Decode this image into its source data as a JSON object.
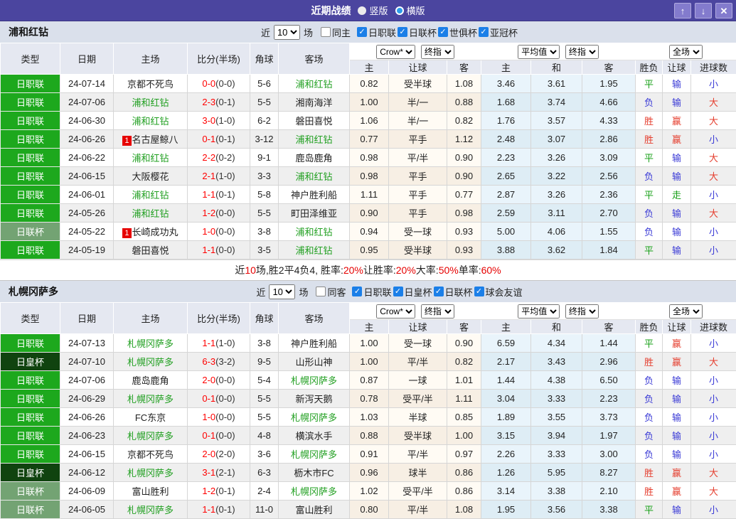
{
  "titlebar": {
    "title": "近期战绩",
    "radios": [
      {
        "label": "竖版",
        "selected": true
      },
      {
        "label": "横版",
        "selected": false
      }
    ],
    "buttons": {
      "up": "↑",
      "down": "↓",
      "close": "✕"
    }
  },
  "icons": {
    "check": "✓"
  },
  "colors": {
    "titlebar_bg": "#4B459F",
    "league": {
      "日职联": "#1DA81D",
      "日联杯": "#73A373",
      "日皇杯": "#10430F"
    },
    "result": {
      "胜": "#E53E2E",
      "负": "#3A3AD6",
      "平": "#19A019",
      "赢": "#E53E2E",
      "输": "#3A3AD6",
      "走": "#19A019",
      "大": "#E53E2E",
      "小": "#3A3AD6"
    },
    "highlight_team": "#22A022",
    "score_red": "#FF0000"
  },
  "table_header": {
    "cols": [
      "类型",
      "日期",
      "主场",
      "比分(半场)",
      "角球",
      "客场"
    ],
    "sub": [
      "主",
      "让球",
      "客",
      "主",
      "和",
      "客",
      "胜负",
      "让球",
      "进球数"
    ]
  },
  "sections": [
    {
      "team": "浦和红钻",
      "near_label": "近",
      "count": "10",
      "matches_label": "场",
      "same_label": "同主",
      "leagues": [
        "日职联",
        "日联杯",
        "世俱杯",
        "亚冠杯"
      ],
      "selects": {
        "book": "Crow*",
        "book_time": "终指",
        "avg": "平均值",
        "avg_time": "终指",
        "scope": "全场"
      },
      "rows": [
        {
          "lg": "日职联",
          "date": "24-07-14",
          "home": "京都不死鸟",
          "mark": "",
          "score": "0-0",
          "half": "(0-0)",
          "corner": "5-6",
          "away": "浦和红钻",
          "o": [
            "0.82",
            "受半球",
            "1.08"
          ],
          "a": [
            "3.46",
            "3.61",
            "1.95"
          ],
          "r": [
            "平",
            "输",
            "小"
          ]
        },
        {
          "lg": "日职联",
          "date": "24-07-06",
          "home": "浦和红钻",
          "mark": "",
          "score": "2-3",
          "half": "(0-1)",
          "corner": "5-5",
          "away": "湘南海洋",
          "o": [
            "1.00",
            "半/一",
            "0.88"
          ],
          "a": [
            "1.68",
            "3.74",
            "4.66"
          ],
          "r": [
            "负",
            "输",
            "大"
          ]
        },
        {
          "lg": "日职联",
          "date": "24-06-30",
          "home": "浦和红钻",
          "mark": "",
          "score": "3-0",
          "half": "(1-0)",
          "corner": "6-2",
          "away": "磐田喜悦",
          "o": [
            "1.06",
            "半/一",
            "0.82"
          ],
          "a": [
            "1.76",
            "3.57",
            "4.33"
          ],
          "r": [
            "胜",
            "赢",
            "大"
          ]
        },
        {
          "lg": "日职联",
          "date": "24-06-26",
          "home": "名古屋鲸八",
          "mark": "1",
          "score": "0-1",
          "half": "(0-1)",
          "corner": "3-12",
          "away": "浦和红钻",
          "o": [
            "0.77",
            "平手",
            "1.12"
          ],
          "a": [
            "2.48",
            "3.07",
            "2.86"
          ],
          "r": [
            "胜",
            "赢",
            "小"
          ]
        },
        {
          "lg": "日职联",
          "date": "24-06-22",
          "home": "浦和红钻",
          "mark": "",
          "score": "2-2",
          "half": "(0-2)",
          "corner": "9-1",
          "away": "鹿岛鹿角",
          "o": [
            "0.98",
            "平/半",
            "0.90"
          ],
          "a": [
            "2.23",
            "3.26",
            "3.09"
          ],
          "r": [
            "平",
            "输",
            "大"
          ]
        },
        {
          "lg": "日职联",
          "date": "24-06-15",
          "home": "大阪樱花",
          "mark": "",
          "score": "2-1",
          "half": "(1-0)",
          "corner": "3-3",
          "away": "浦和红钻",
          "o": [
            "0.98",
            "平手",
            "0.90"
          ],
          "a": [
            "2.65",
            "3.22",
            "2.56"
          ],
          "r": [
            "负",
            "输",
            "大"
          ]
        },
        {
          "lg": "日职联",
          "date": "24-06-01",
          "home": "浦和红钻",
          "mark": "",
          "score": "1-1",
          "half": "(0-1)",
          "corner": "5-8",
          "away": "神户胜利船",
          "o": [
            "1.11",
            "平手",
            "0.77"
          ],
          "a": [
            "2.87",
            "3.26",
            "2.36"
          ],
          "r": [
            "平",
            "走",
            "小"
          ]
        },
        {
          "lg": "日职联",
          "date": "24-05-26",
          "home": "浦和红钻",
          "mark": "",
          "score": "1-2",
          "half": "(0-0)",
          "corner": "5-5",
          "away": "町田泽维亚",
          "o": [
            "0.90",
            "平手",
            "0.98"
          ],
          "a": [
            "2.59",
            "3.11",
            "2.70"
          ],
          "r": [
            "负",
            "输",
            "大"
          ]
        },
        {
          "lg": "日联杯",
          "date": "24-05-22",
          "home": "长崎成功丸",
          "mark": "1",
          "score": "1-0",
          "half": "(0-0)",
          "corner": "3-8",
          "away": "浦和红钻",
          "o": [
            "0.94",
            "受一球",
            "0.93"
          ],
          "a": [
            "5.00",
            "4.06",
            "1.55"
          ],
          "r": [
            "负",
            "输",
            "小"
          ]
        },
        {
          "lg": "日职联",
          "date": "24-05-19",
          "home": "磐田喜悦",
          "mark": "",
          "score": "1-1",
          "half": "(0-0)",
          "corner": "3-5",
          "away": "浦和红钻",
          "o": [
            "0.95",
            "受半球",
            "0.93"
          ],
          "a": [
            "3.88",
            "3.62",
            "1.84"
          ],
          "r": [
            "平",
            "输",
            "小"
          ]
        }
      ],
      "summary": [
        {
          "t": "近",
          "red": false
        },
        {
          "t": "10",
          "red": true
        },
        {
          "t": "场,胜2平4负4, 胜率:",
          "red": false
        },
        {
          "t": "20%",
          "red": true
        },
        {
          "t": " 让胜率:",
          "red": false
        },
        {
          "t": "20%",
          "red": true
        },
        {
          "t": " 大率:",
          "red": false
        },
        {
          "t": "50%",
          "red": true
        },
        {
          "t": " 单率:",
          "red": false
        },
        {
          "t": "60%",
          "red": true
        }
      ]
    },
    {
      "team": "札幌冈萨多",
      "near_label": "近",
      "count": "10",
      "matches_label": "场",
      "same_label": "同客",
      "leagues": [
        "日职联",
        "日皇杯",
        "日联杯",
        "球会友谊"
      ],
      "selects": {
        "book": "Crow*",
        "book_time": "终指",
        "avg": "平均值",
        "avg_time": "终指",
        "scope": "全场"
      },
      "rows": [
        {
          "lg": "日职联",
          "date": "24-07-13",
          "home": "札幌冈萨多",
          "mark": "",
          "score": "1-1",
          "half": "(1-0)",
          "corner": "3-8",
          "away": "神户胜利船",
          "o": [
            "1.00",
            "受一球",
            "0.90"
          ],
          "a": [
            "6.59",
            "4.34",
            "1.44"
          ],
          "r": [
            "平",
            "赢",
            "小"
          ]
        },
        {
          "lg": "日皇杯",
          "date": "24-07-10",
          "home": "札幌冈萨多",
          "mark": "",
          "score": "6-3",
          "half": "(3-2)",
          "corner": "9-5",
          "away": "山形山神",
          "o": [
            "1.00",
            "平/半",
            "0.82"
          ],
          "a": [
            "2.17",
            "3.43",
            "2.96"
          ],
          "r": [
            "胜",
            "赢",
            "大"
          ]
        },
        {
          "lg": "日职联",
          "date": "24-07-06",
          "home": "鹿岛鹿角",
          "mark": "",
          "score": "2-0",
          "half": "(0-0)",
          "corner": "5-4",
          "away": "札幌冈萨多",
          "o": [
            "0.87",
            "一球",
            "1.01"
          ],
          "a": [
            "1.44",
            "4.38",
            "6.50"
          ],
          "r": [
            "负",
            "输",
            "小"
          ]
        },
        {
          "lg": "日职联",
          "date": "24-06-29",
          "home": "札幌冈萨多",
          "mark": "",
          "score": "0-1",
          "half": "(0-0)",
          "corner": "5-5",
          "away": "新泻天鹅",
          "o": [
            "0.78",
            "受平/半",
            "1.11"
          ],
          "a": [
            "3.04",
            "3.33",
            "2.23"
          ],
          "r": [
            "负",
            "输",
            "小"
          ]
        },
        {
          "lg": "日职联",
          "date": "24-06-26",
          "home": "FC东京",
          "mark": "",
          "score": "1-0",
          "half": "(0-0)",
          "corner": "5-5",
          "away": "札幌冈萨多",
          "o": [
            "1.03",
            "半球",
            "0.85"
          ],
          "a": [
            "1.89",
            "3.55",
            "3.73"
          ],
          "r": [
            "负",
            "输",
            "小"
          ]
        },
        {
          "lg": "日职联",
          "date": "24-06-23",
          "home": "札幌冈萨多",
          "mark": "",
          "score": "0-1",
          "half": "(0-0)",
          "corner": "4-8",
          "away": "横滨水手",
          "o": [
            "0.88",
            "受半球",
            "1.00"
          ],
          "a": [
            "3.15",
            "3.94",
            "1.97"
          ],
          "r": [
            "负",
            "输",
            "小"
          ]
        },
        {
          "lg": "日职联",
          "date": "24-06-15",
          "home": "京都不死鸟",
          "mark": "",
          "score": "2-0",
          "half": "(2-0)",
          "corner": "3-6",
          "away": "札幌冈萨多",
          "o": [
            "0.91",
            "平/半",
            "0.97"
          ],
          "a": [
            "2.26",
            "3.33",
            "3.00"
          ],
          "r": [
            "负",
            "输",
            "小"
          ]
        },
        {
          "lg": "日皇杯",
          "date": "24-06-12",
          "home": "札幌冈萨多",
          "mark": "",
          "score": "3-1",
          "half": "(2-1)",
          "corner": "6-3",
          "away": "枥木市FC",
          "o": [
            "0.96",
            "球半",
            "0.86"
          ],
          "a": [
            "1.26",
            "5.95",
            "8.27"
          ],
          "r": [
            "胜",
            "赢",
            "大"
          ]
        },
        {
          "lg": "日联杯",
          "date": "24-06-09",
          "home": "富山胜利",
          "mark": "",
          "score": "1-2",
          "half": "(0-1)",
          "corner": "2-4",
          "away": "札幌冈萨多",
          "o": [
            "1.02",
            "受平/半",
            "0.86"
          ],
          "a": [
            "3.14",
            "3.38",
            "2.10"
          ],
          "r": [
            "胜",
            "赢",
            "大"
          ]
        },
        {
          "lg": "日联杯",
          "date": "24-06-05",
          "home": "札幌冈萨多",
          "mark": "",
          "score": "1-1",
          "half": "(0-1)",
          "corner": "11-0",
          "away": "富山胜利",
          "o": [
            "0.80",
            "平/半",
            "1.08"
          ],
          "a": [
            "1.95",
            "3.56",
            "3.38"
          ],
          "r": [
            "平",
            "输",
            "小"
          ]
        }
      ],
      "summary": null
    }
  ]
}
